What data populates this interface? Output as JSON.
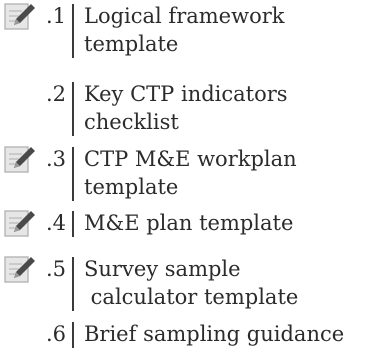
{
  "toc": {
    "items": [
      {
        "number": ".1",
        "lines": [
          "Logical framework",
          "template"
        ],
        "has_icon": true,
        "icon": "edit-document-icon"
      },
      {
        "number": ".2",
        "lines": [
          "Key CTP indicators",
          "checklist"
        ],
        "has_icon": false
      },
      {
        "number": ".3",
        "lines": [
          "CTP M&E workplan",
          "template"
        ],
        "has_icon": true,
        "icon": "edit-document-icon"
      },
      {
        "number": ".4",
        "lines": [
          "M&E plan template"
        ],
        "has_icon": true,
        "icon": "edit-document-icon"
      },
      {
        "number": ".5",
        "lines": [
          "Survey sample",
          " calculator template"
        ],
        "has_icon": true,
        "icon": "edit-document-icon"
      },
      {
        "number": ".6",
        "lines": [
          "Brief sampling guidance"
        ],
        "has_icon": false
      }
    ]
  },
  "colors": {
    "icon_bg": "#e6e6e6",
    "icon_stroke": "#b5b5b5",
    "icon_pen": "#4a4a4a",
    "text": "#2b2b2b"
  }
}
